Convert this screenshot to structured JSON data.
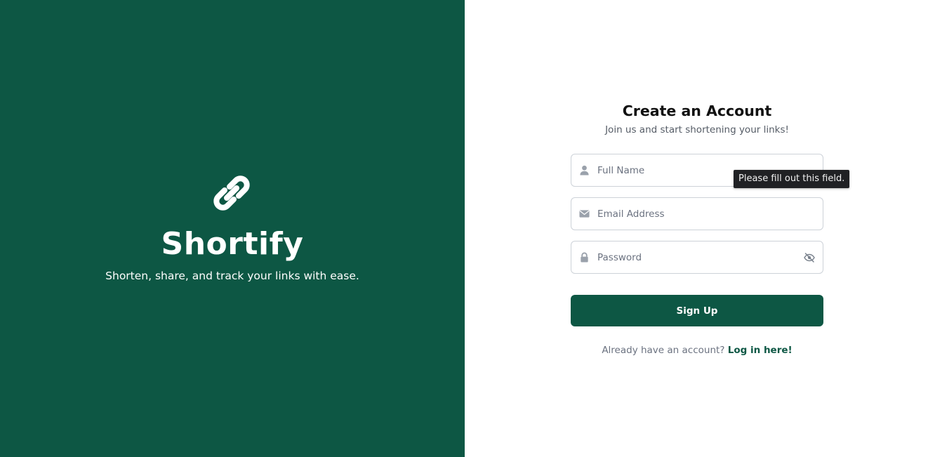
{
  "brand": {
    "logo_icon": "link-icon",
    "name": "Shortify",
    "tagline": "Shorten, share, and track your links with ease.",
    "background_color": "#0d5744"
  },
  "form": {
    "title": "Create an Account",
    "subtitle": "Join us and start shortening your links!",
    "fields": {
      "full_name": {
        "placeholder": "Full Name",
        "value": "",
        "icon": "user-icon"
      },
      "email": {
        "placeholder": "Email Address",
        "value": "",
        "icon": "envelope-icon"
      },
      "password": {
        "placeholder": "Password",
        "value": "",
        "icon": "lock-icon",
        "toggle_icon": "eye-slash-icon"
      }
    },
    "tooltip": "Please fill out this field.",
    "submit_label": "Sign Up",
    "login_prompt": "Already have an account?",
    "login_link": "Log in here!",
    "accent_color": "#0d5744"
  }
}
